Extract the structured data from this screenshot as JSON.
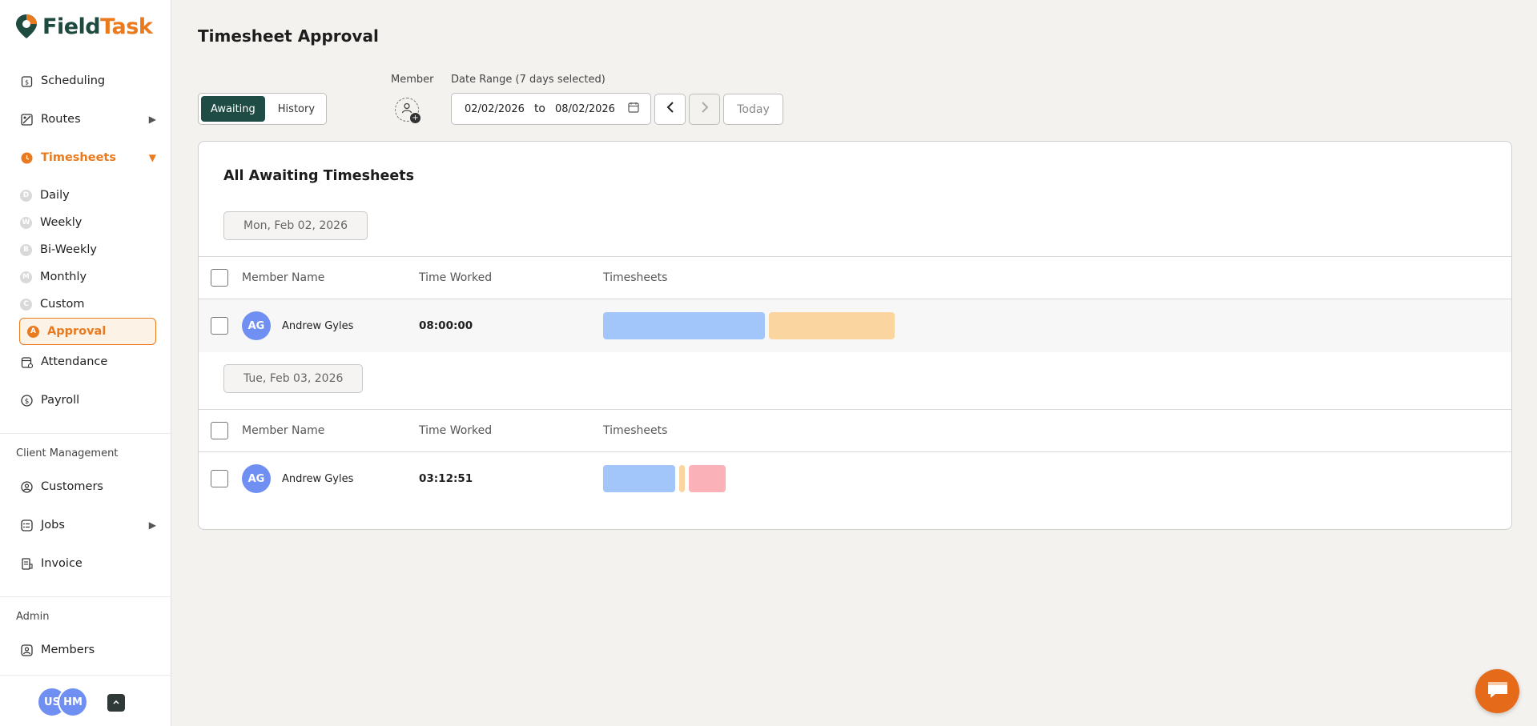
{
  "app": {
    "logo_part1": "Field",
    "logo_part2": "Task"
  },
  "sidebar": {
    "nav": [
      {
        "label": "Scheduling"
      },
      {
        "label": "Routes"
      },
      {
        "label": "Timesheets"
      },
      {
        "label": "Attendance"
      },
      {
        "label": "Payroll"
      }
    ],
    "timesheet_sub": [
      {
        "badge": "D",
        "label": "Daily"
      },
      {
        "badge": "W",
        "label": "Weekly"
      },
      {
        "badge": "B",
        "label": "Bi-Weekly"
      },
      {
        "badge": "M",
        "label": "Monthly"
      },
      {
        "badge": "C",
        "label": "Custom"
      },
      {
        "badge": "A",
        "label": "Approval"
      }
    ],
    "client_section": "Client Management",
    "client_nav": [
      {
        "label": "Customers"
      },
      {
        "label": "Jobs"
      },
      {
        "label": "Invoice"
      }
    ],
    "admin_section": "Admin",
    "admin_nav": [
      {
        "label": "Members"
      }
    ],
    "users": [
      "US",
      "HM"
    ]
  },
  "header": {
    "title": "Timesheet Approval",
    "toggle": {
      "awaiting": "Awaiting",
      "history": "History"
    },
    "member_label": "Member",
    "date_range_label": "Date Range (7 days selected)",
    "date_from": "02/02/2026",
    "date_to_word": "to",
    "date_to": "08/02/2026",
    "today_label": "Today"
  },
  "card": {
    "title": "All Awaiting Timesheets",
    "columns": {
      "name": "Member Name",
      "time": "Time Worked",
      "timesheets": "Timesheets"
    },
    "groups": [
      {
        "date": "Mon, Feb 02, 2026",
        "rows": [
          {
            "initials": "AG",
            "name": "Andrew Gyles",
            "time_worked": "08:00:00",
            "entries": [
              {
                "color": "#a2c5fa"
              },
              {
                "color": "#fad5a0"
              }
            ]
          }
        ]
      },
      {
        "date": "Tue, Feb 03, 2026",
        "rows": [
          {
            "initials": "AG",
            "name": "Andrew Gyles",
            "time_worked": "03:12:51",
            "entries": [
              {
                "color": "#a2c5fa"
              },
              {
                "color": "#fad5a0"
              },
              {
                "color": "#fbb1b8"
              }
            ]
          }
        ]
      }
    ]
  },
  "colors": {
    "accent": "#ea7a1e",
    "primary_dark": "#1f4d45",
    "avatar": "#6f8ff3"
  }
}
